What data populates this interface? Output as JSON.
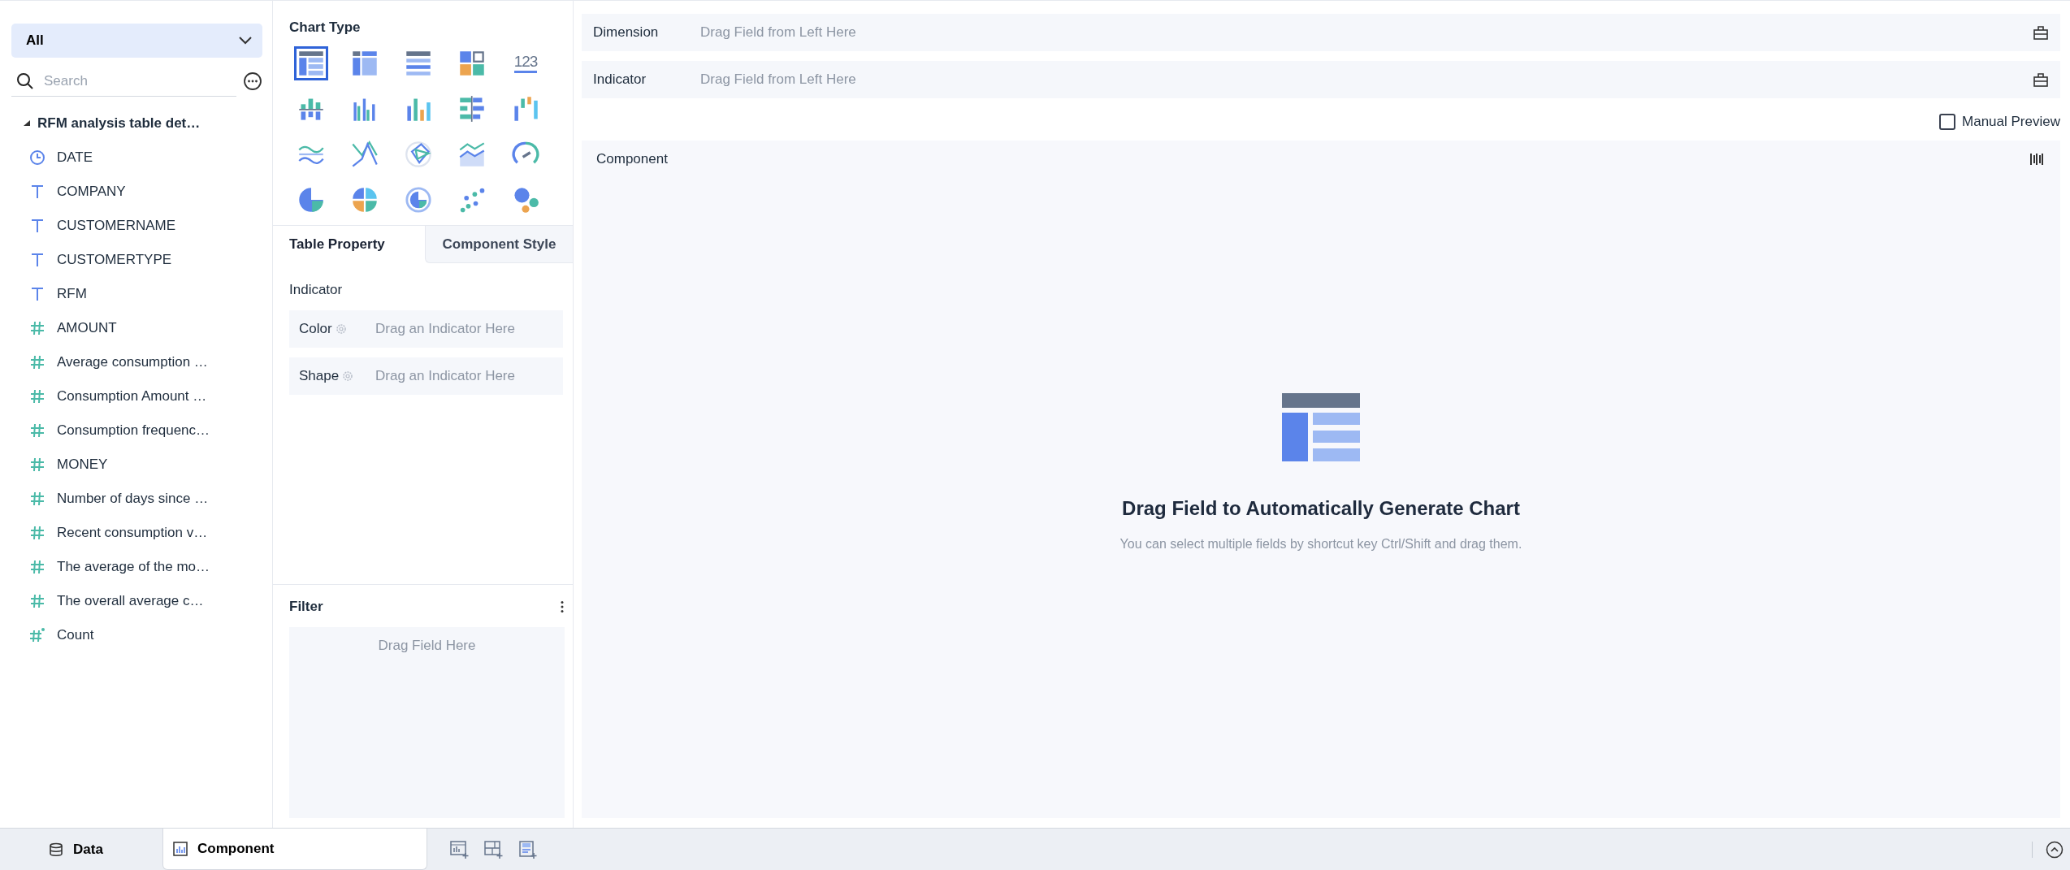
{
  "fields_panel": {
    "dropdown": "All",
    "search": {
      "placeholder": "Search"
    },
    "tree": {
      "label": "RFM analysis table det…",
      "expanded": true,
      "children": [
        {
          "label": "DATE",
          "kind": "date"
        },
        {
          "label": "COMPANY",
          "kind": "text"
        },
        {
          "label": "CUSTOMERNAME",
          "kind": "text"
        },
        {
          "label": "CUSTOMERTYPE",
          "kind": "text"
        },
        {
          "label": "RFM",
          "kind": "text"
        },
        {
          "label": "AMOUNT",
          "kind": "number"
        },
        {
          "label": "Average consumption …",
          "kind": "number"
        },
        {
          "label": "Consumption Amount …",
          "kind": "number"
        },
        {
          "label": "Consumption frequenc…",
          "kind": "number"
        },
        {
          "label": "MONEY",
          "kind": "number"
        },
        {
          "label": "Number of days since …",
          "kind": "number"
        },
        {
          "label": "Recent consumption v…",
          "kind": "number"
        },
        {
          "label": "The average of the mo…",
          "kind": "number"
        },
        {
          "label": "The overall average c…",
          "kind": "number"
        },
        {
          "label": "Count",
          "kind": "count"
        }
      ]
    }
  },
  "chart_type": {
    "title": "Chart Type",
    "types": [
      {
        "kind": "table",
        "selected": true
      },
      {
        "kind": "crosstab",
        "selected": false
      },
      {
        "kind": "detail",
        "selected": false
      },
      {
        "kind": "tiles",
        "selected": false
      },
      {
        "kind": "number",
        "label": "123",
        "selected": false
      },
      {
        "kind": "stacked-bars",
        "selected": false
      },
      {
        "kind": "grouped-bars",
        "selected": false
      },
      {
        "kind": "bars",
        "selected": false
      },
      {
        "kind": "hbars",
        "selected": false
      },
      {
        "kind": "waterfall",
        "selected": false
      },
      {
        "kind": "lines",
        "selected": false
      },
      {
        "kind": "cross-lines",
        "selected": false
      },
      {
        "kind": "radar",
        "selected": false
      },
      {
        "kind": "area",
        "selected": false
      },
      {
        "kind": "gauge",
        "selected": false
      },
      {
        "kind": "pie",
        "selected": false
      },
      {
        "kind": "quad-pie",
        "selected": false
      },
      {
        "kind": "ring",
        "selected": false
      },
      {
        "kind": "scatter",
        "selected": false
      },
      {
        "kind": "bubble",
        "selected": false
      }
    ]
  },
  "property_tabs": [
    {
      "label": "Table Property",
      "selected": true
    },
    {
      "label": "Component Style",
      "selected": false
    }
  ],
  "indicator": {
    "title": "Indicator",
    "slots": [
      {
        "label": "Color",
        "placeholder": "Drag an Indicator Here"
      },
      {
        "label": "Shape",
        "placeholder": "Drag an Indicator Here"
      }
    ]
  },
  "filter": {
    "title": "Filter",
    "placeholder": "Drag Field Here"
  },
  "shelves": [
    {
      "label": "Dimension",
      "placeholder": "Drag Field from Left Here"
    },
    {
      "label": "Indicator",
      "placeholder": "Drag Field from Left Here"
    }
  ],
  "manual_preview": {
    "label": "Manual Preview",
    "checked": false
  },
  "component": {
    "title": "Component",
    "empty_title": "Drag Field to Automatically Generate Chart",
    "empty_hint": "You can select multiple fields by shortcut key Ctrl/Shift and drag them."
  },
  "bottom_tabs": [
    {
      "label": "Data",
      "kind": "data",
      "selected": false
    },
    {
      "label": "Component",
      "kind": "component",
      "selected": true
    }
  ]
}
